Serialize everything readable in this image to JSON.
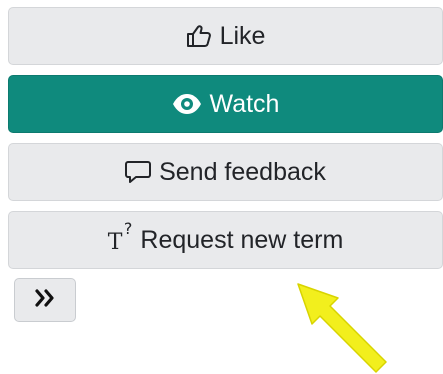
{
  "actions": {
    "like_label": "Like",
    "watch_label": "Watch",
    "feedback_label": "Send feedback",
    "request_term_label": "Request new term",
    "request_term_icon_text": "T",
    "request_term_icon_sup": "?"
  },
  "icons": {
    "like": "thumbs-up-icon",
    "watch": "eye-icon",
    "feedback": "speech-bubble-icon",
    "request_term": "term-question-icon",
    "expand": "double-chevron-right-icon",
    "annotation": "pointer-arrow-icon"
  },
  "colors": {
    "primary": "#0f8a7d",
    "button_bg": "#e9eaec",
    "annotation_arrow": "#f2ef1d"
  }
}
